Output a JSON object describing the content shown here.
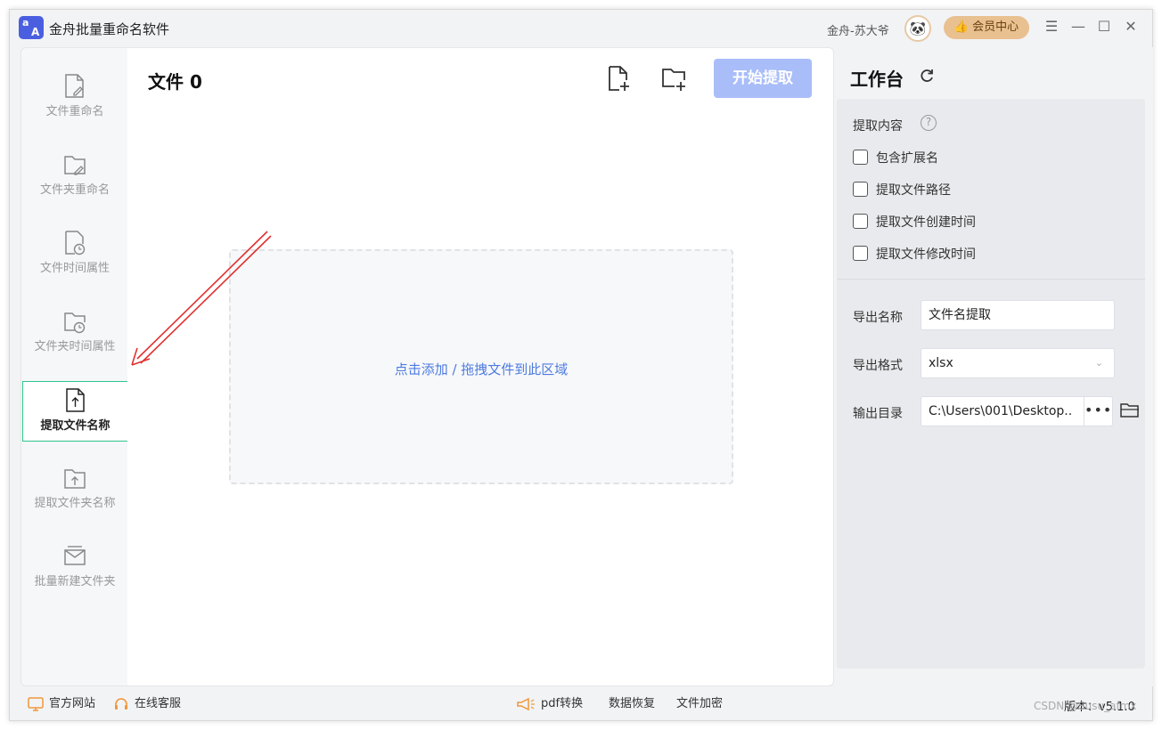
{
  "app": {
    "title": "金舟批量重命名软件",
    "logo_text_top": "a",
    "logo_text_bottom": "A"
  },
  "header": {
    "user_name": "金舟-苏大爷",
    "vip_label": "会员中心",
    "avatar_icon": "panda-avatar"
  },
  "sidebar": {
    "items": [
      {
        "label": "文件重命名",
        "icon": "file-edit-icon"
      },
      {
        "label": "文件夹重命名",
        "icon": "folder-edit-icon"
      },
      {
        "label": "文件时间属性",
        "icon": "file-clock-icon"
      },
      {
        "label": "文件夹时间属性",
        "icon": "folder-clock-icon"
      },
      {
        "label": "提取文件名称",
        "icon": "file-upload-icon",
        "active": true
      },
      {
        "label": "提取文件夹名称",
        "icon": "folder-upload-icon"
      },
      {
        "label": "批量新建文件夹",
        "icon": "folder-new-icon"
      }
    ]
  },
  "main": {
    "file_count_title": "文件 0",
    "start_button": "开始提取",
    "dropzone_text": "点击添加 / 拖拽文件到此区域"
  },
  "workbench": {
    "title": "工作台",
    "extract_label": "提取内容",
    "options": [
      {
        "label": "包含扩展名",
        "checked": false
      },
      {
        "label": "提取文件路径",
        "checked": false
      },
      {
        "label": "提取文件创建时间",
        "checked": false
      },
      {
        "label": "提取文件修改时间",
        "checked": false
      }
    ],
    "export_name_label": "导出名称",
    "export_name_value": "文件名提取",
    "export_format_label": "导出格式",
    "export_format_value": "xlsx",
    "output_dir_label": "输出目录",
    "output_dir_value": "C:\\Users\\001\\Desktop..",
    "browse_label": "•••"
  },
  "footer": {
    "official_site": "官方网站",
    "online_service": "在线客服",
    "pdf_convert": "pdf转换",
    "data_recovery": "数据恢复",
    "file_encrypt": "文件加密",
    "version": "版本：v5.1.0"
  },
  "watermark": "CSDN @Susu_afmx",
  "colors": {
    "accent": "#4a5fe0",
    "start_button": "#a9bdf9",
    "active_border": "#31c48d",
    "vip": "#e9c08f",
    "link": "#4d7be0",
    "arrow": "#e0312f"
  }
}
